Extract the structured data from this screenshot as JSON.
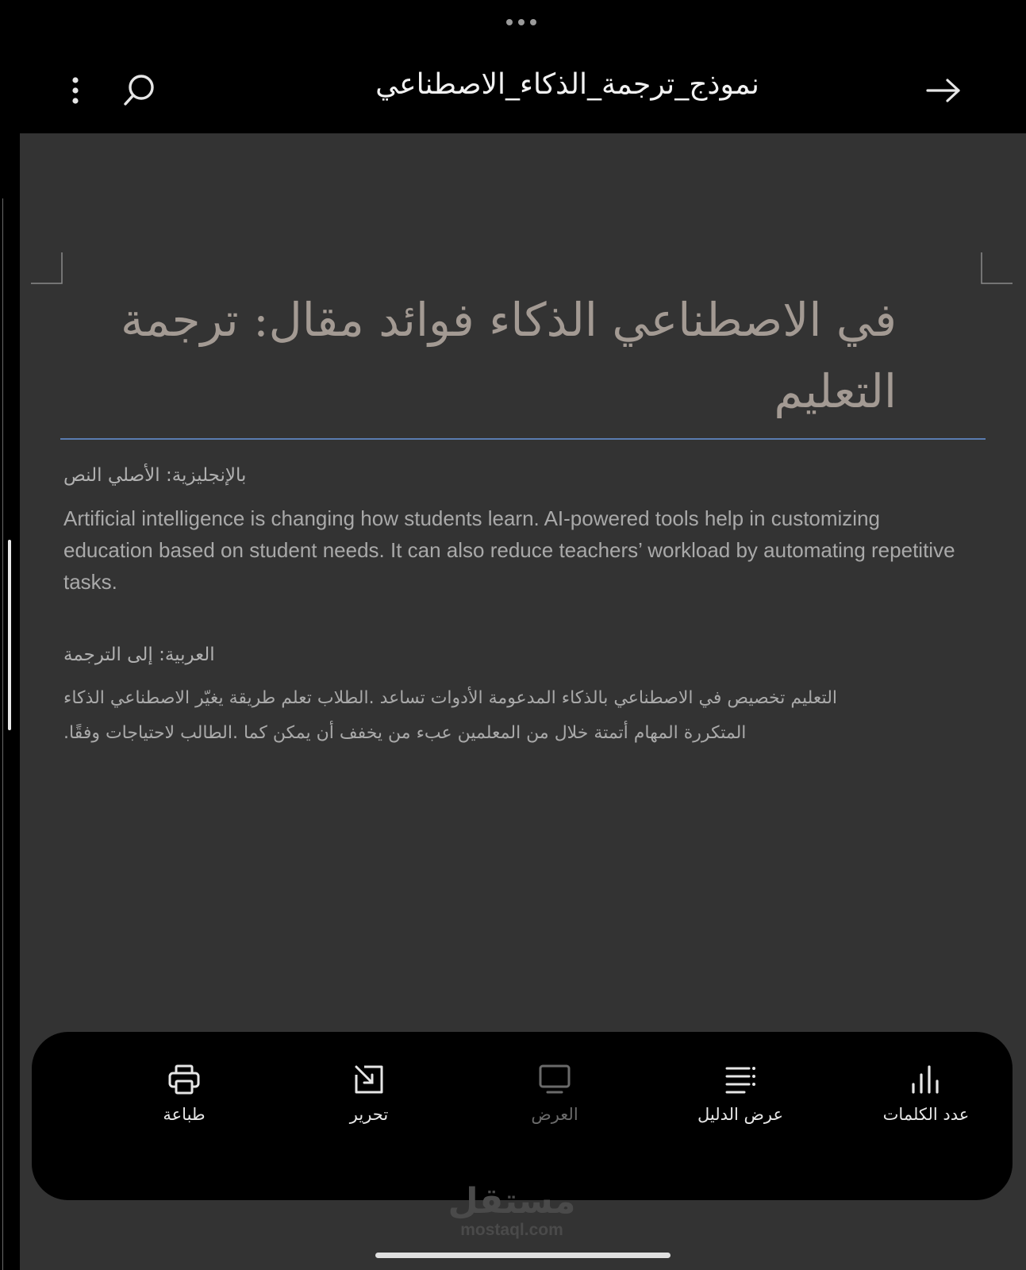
{
  "header": {
    "document_title": "نموذج_ترجمة_الذكاء_الاصطناعي",
    "more_icon": "more-vertical-icon",
    "search_icon": "search-icon",
    "back_icon": "arrow-right-icon"
  },
  "document": {
    "heading_line1": "في الاصطناعي الذكاء فوائد مقال: ترجمة",
    "heading_line2": "التعليم",
    "original_label": "بالإنجليزية: الأصلي النص",
    "original_text": "Artificial intelligence is changing how students learn. AI-powered tools help in customizing education based on student needs. It can also reduce teachers’ workload by automating repetitive tasks.",
    "translation_label": "العربية: إلى الترجمة",
    "translation_line1": "التعليم تخصيص في الاصطناعي بالذكاء المدعومة الأدوات تساعد .الطلاب تعلم طريقة يغيّر الاصطناعي الذكاء",
    "translation_line2": "المتكررة المهام أتمتة خلال من المعلمين عبء من يخفف أن يمكن كما .الطالب لاحتياجات وفقًا."
  },
  "toolbar": {
    "print_label": "طباعة",
    "edit_label": "تحرير",
    "view_label": "العرض",
    "outline_label": "عرض الدليل",
    "word_count_label": "عدد الكلمات"
  },
  "watermark": {
    "arabic": "مستقل",
    "latin": "mostaql.com"
  },
  "colors": {
    "page_background": "#333333",
    "heading_color": "#a39a93",
    "heading_rule": "#5a7cb0",
    "bar_background": "#000000"
  }
}
